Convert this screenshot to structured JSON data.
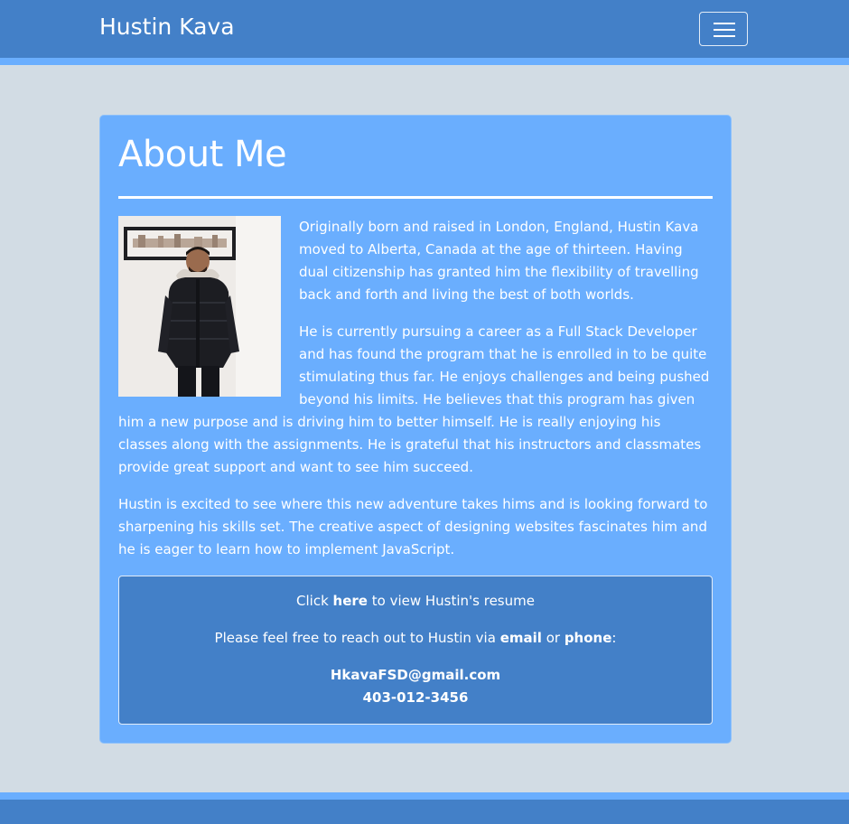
{
  "navbar": {
    "brand": "Hustin Kava"
  },
  "about": {
    "title": "About Me",
    "paragraphs": [
      "Originally born and raised in London, England, Hustin Kava moved to Alberta, Canada at the age of thirteen. Having dual citizenship has granted him the flexibility of travelling back and forth and living the best of both worlds.",
      "He is currently pursuing a career as a Full Stack Developer and has found the program that he is enrolled in to be quite stimulating thus far. He enjoys challenges and being pushed beyond his limits. He believes that this program has given him a new purpose and is driving him to better himself. He is really enjoying his classes along with the assignments. He is grateful that his instructors and classmates provide great support and want to see him succeed.",
      "Hustin is excited to see where this new adventure takes hims and is looking forward to sharpening his skills set. The creative aspect of designing websites fascinates him and he is eager to learn how to implement JavaScript."
    ]
  },
  "contact": {
    "resume_prefix": "Click ",
    "resume_link": "here",
    "resume_suffix": " to view Hustin's resume",
    "reach_prefix": "Please feel free to reach out to Hustin via ",
    "email_label": "email",
    "reach_mid": " or ",
    "phone_label": "phone",
    "reach_suffix": ":",
    "email": "HkavaFSD@gmail.com",
    "phone": "403-012-3456"
  },
  "colors": {
    "navbar": "#4380c8",
    "accent": "#6aaefe",
    "page_bg": "#d2dce4"
  },
  "icons": {
    "menu": "hamburger-menu-icon"
  }
}
